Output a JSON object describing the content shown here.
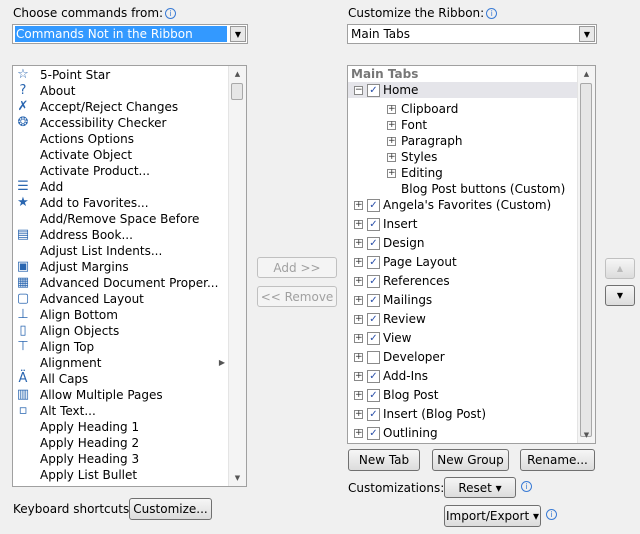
{
  "left": {
    "label": "Choose commands from:",
    "combo_value": "Commands Not in the Ribbon",
    "items": [
      {
        "label": "5-Point Star",
        "icon": "star-icon",
        "g": "☆"
      },
      {
        "label": "About",
        "icon": "help-icon",
        "g": "?"
      },
      {
        "label": "Accept/Reject Changes",
        "icon": "accept-reject-icon",
        "g": "✗"
      },
      {
        "label": "Accessibility Checker",
        "icon": "accessibility-icon",
        "g": "❂"
      },
      {
        "label": "Actions Options",
        "icon": "",
        "g": ""
      },
      {
        "label": "Activate Object",
        "icon": "",
        "g": ""
      },
      {
        "label": "Activate Product...",
        "icon": "",
        "g": ""
      },
      {
        "label": "Add",
        "icon": "add-icon",
        "g": "☰"
      },
      {
        "label": "Add to Favorites...",
        "icon": "favorites-icon",
        "g": "★"
      },
      {
        "label": "Add/Remove Space Before",
        "icon": "",
        "g": ""
      },
      {
        "label": "Address Book...",
        "icon": "address-book-icon",
        "g": "▤"
      },
      {
        "label": "Adjust List Indents...",
        "icon": "",
        "g": ""
      },
      {
        "label": "Adjust Margins",
        "icon": "margins-icon",
        "g": "▣"
      },
      {
        "label": "Advanced Document Proper...",
        "icon": "document-properties-icon",
        "g": "▦"
      },
      {
        "label": "Advanced Layout",
        "icon": "layout-icon",
        "g": "▢"
      },
      {
        "label": "Align Bottom",
        "icon": "align-bottom-icon",
        "g": "⊥"
      },
      {
        "label": "Align Objects",
        "icon": "align-objects-icon",
        "g": "▯"
      },
      {
        "label": "Align Top",
        "icon": "align-top-icon",
        "g": "⊤"
      },
      {
        "label": "Alignment",
        "icon": "",
        "g": "",
        "sub": true
      },
      {
        "label": "All Caps",
        "icon": "all-caps-icon",
        "g": "Ä"
      },
      {
        "label": "Allow Multiple Pages",
        "icon": "multiple-pages-icon",
        "g": "▥"
      },
      {
        "label": "Alt Text...",
        "icon": "alt-text-icon",
        "g": "▫"
      },
      {
        "label": "Apply Heading 1",
        "icon": "",
        "g": ""
      },
      {
        "label": "Apply Heading 2",
        "icon": "",
        "g": ""
      },
      {
        "label": "Apply Heading 3",
        "icon": "",
        "g": ""
      },
      {
        "label": "Apply List Bullet",
        "icon": "",
        "g": ""
      }
    ]
  },
  "right": {
    "label": "Customize the Ribbon:",
    "combo_value": "Main Tabs",
    "tree_header": "Main Tabs",
    "home": {
      "label": "Home",
      "checked": true,
      "groups": [
        "Clipboard",
        "Font",
        "Paragraph",
        "Styles",
        "Editing"
      ],
      "custom_group": "Blog Post buttons (Custom)"
    },
    "tabs": [
      {
        "label": "Angela's Favorites (Custom)",
        "checked": true
      },
      {
        "label": "Insert",
        "checked": true
      },
      {
        "label": "Design",
        "checked": true
      },
      {
        "label": "Page Layout",
        "checked": true
      },
      {
        "label": "References",
        "checked": true
      },
      {
        "label": "Mailings",
        "checked": true
      },
      {
        "label": "Review",
        "checked": true
      },
      {
        "label": "View",
        "checked": true
      },
      {
        "label": "Developer",
        "checked": false
      },
      {
        "label": "Add-Ins",
        "checked": true
      },
      {
        "label": "Blog Post",
        "checked": true
      },
      {
        "label": "Insert (Blog Post)",
        "checked": true
      },
      {
        "label": "Outlining",
        "checked": true
      }
    ]
  },
  "buttons": {
    "add": "Add >>",
    "remove": "<< Remove",
    "new_tab": "New Tab",
    "new_group": "New Group",
    "rename": "Rename...",
    "reset": "Reset ▾",
    "import_export": "Import/Export ▾",
    "customize": "Customize..."
  },
  "labels": {
    "keyboard_shortcuts": "Keyboard shortcuts:",
    "customizations": "Customizations:"
  },
  "colors": {
    "selection": "#3399ff",
    "home_highlight": "#e5e5ea"
  }
}
